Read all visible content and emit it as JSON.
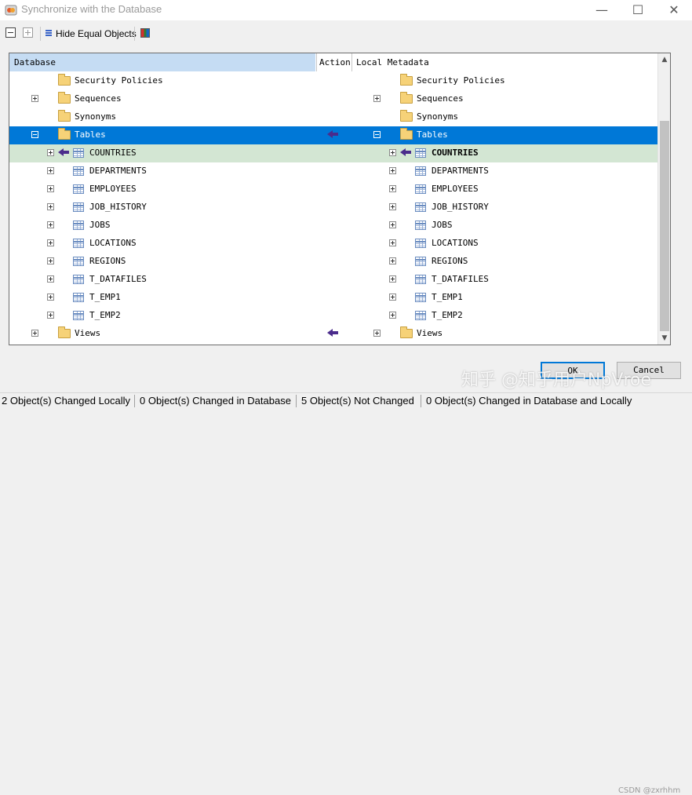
{
  "window": {
    "title": "Synchronize with the Database",
    "minimize_glyph": "—",
    "maximize_glyph": "☐",
    "close_glyph": "✕"
  },
  "toolbar": {
    "hide_equal_label": "Hide Equal Objects",
    "icons": [
      "collapse-all-icon",
      "expand-all-icon",
      "hide-equal-icon",
      "color-legend-icon"
    ]
  },
  "columns": {
    "database": "Database",
    "action": "Action",
    "local": "Local Metadata"
  },
  "tree": {
    "rows": [
      {
        "name": "Security Policies",
        "icon": "folder",
        "expander": null,
        "action": null,
        "state": "normal"
      },
      {
        "name": "Sequences",
        "icon": "folder",
        "expander": "plus",
        "action": null,
        "state": "normal"
      },
      {
        "name": "Synonyms",
        "icon": "folder",
        "expander": null,
        "action": null,
        "state": "normal"
      },
      {
        "name": "Tables",
        "icon": "folder",
        "expander": "minus",
        "action": "to-local",
        "state": "selected"
      },
      {
        "name": "COUNTRIES",
        "icon": "table",
        "expander": "plus",
        "action": "to-local",
        "state": "changed"
      },
      {
        "name": "DEPARTMENTS",
        "icon": "table",
        "expander": "plus",
        "action": null,
        "state": "normal"
      },
      {
        "name": "EMPLOYEES",
        "icon": "table",
        "expander": "plus",
        "action": null,
        "state": "normal"
      },
      {
        "name": "JOB_HISTORY",
        "icon": "table",
        "expander": "plus",
        "action": null,
        "state": "normal"
      },
      {
        "name": "JOBS",
        "icon": "table",
        "expander": "plus",
        "action": null,
        "state": "normal"
      },
      {
        "name": "LOCATIONS",
        "icon": "table",
        "expander": "plus",
        "action": null,
        "state": "normal"
      },
      {
        "name": "REGIONS",
        "icon": "table",
        "expander": "plus",
        "action": null,
        "state": "normal"
      },
      {
        "name": "T_DATAFILES",
        "icon": "table",
        "expander": "plus",
        "action": null,
        "state": "normal"
      },
      {
        "name": "T_EMP1",
        "icon": "table",
        "expander": "plus",
        "action": null,
        "state": "normal"
      },
      {
        "name": "T_EMP2",
        "icon": "table",
        "expander": "plus",
        "action": null,
        "state": "normal"
      },
      {
        "name": "Views",
        "icon": "folder",
        "expander": "plus",
        "action": "to-local",
        "state": "normal"
      }
    ]
  },
  "buttons": {
    "ok": "OK",
    "cancel": "Cancel"
  },
  "status": {
    "changed_locally": "2 Object(s) Changed Locally",
    "changed_in_db": "0 Object(s) Changed in Database",
    "not_changed": "5 Object(s) Not Changed",
    "changed_both": "0 Object(s) Changed in Database and Locally"
  },
  "watermark": {
    "main": "知乎 @知乎用户NpVroe",
    "small": "CSDN @zxrhhm"
  },
  "colors": {
    "selected_row": "#0078d7",
    "changed_row": "#d3e6d3",
    "header_highlight": "#c5dcf3",
    "action_arrow": "#4b2c8c"
  }
}
